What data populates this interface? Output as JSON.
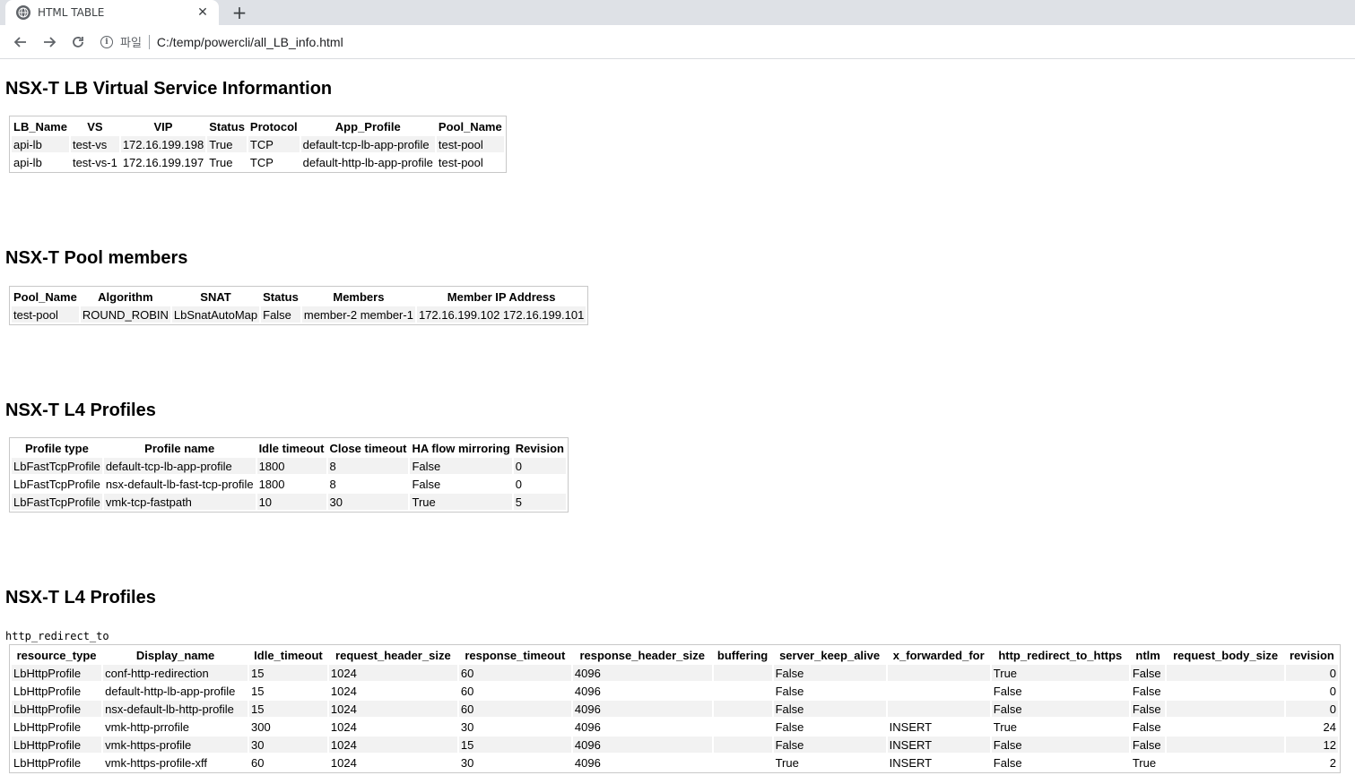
{
  "browser": {
    "tab_title": "HTML TABLE",
    "new_tab_glyph": "+",
    "close_glyph": "✕",
    "scheme_label": "파일",
    "url": "C:/temp/powercli/all_LB_info.html"
  },
  "sections": {
    "vs": {
      "title": "NSX-T LB Virtual Service Informantion",
      "headers": [
        "LB_Name",
        "VS",
        "VIP",
        "Status",
        "Protocol",
        "App_Profile",
        "Pool_Name"
      ],
      "rows": [
        [
          "api-lb",
          "test-vs",
          "172.16.199.198",
          "True",
          "TCP",
          "default-tcp-lb-app-profile",
          "test-pool"
        ],
        [
          "api-lb",
          "test-vs-1",
          "172.16.199.197",
          "True",
          "TCP",
          "default-http-lb-app-profile",
          "test-pool"
        ]
      ]
    },
    "pool": {
      "title": "NSX-T Pool members",
      "headers": [
        "Pool_Name",
        "Algorithm",
        "SNAT",
        "Status",
        "Members",
        "Member IP Address"
      ],
      "rows": [
        [
          "test-pool",
          "ROUND_ROBIN",
          "LbSnatAutoMap",
          "False",
          "member-2 member-1",
          "172.16.199.102 172.16.199.101"
        ]
      ]
    },
    "l4": {
      "title": "NSX-T L4 Profiles",
      "headers": [
        "Profile type",
        "Profile name",
        "Idle timeout",
        "Close timeout",
        "HA flow mirroring",
        "Revision"
      ],
      "rows": [
        [
          "LbFastTcpProfile",
          "default-tcp-lb-app-profile",
          "1800",
          "8",
          "False",
          "0"
        ],
        [
          "LbFastTcpProfile",
          "nsx-default-lb-fast-tcp-profile",
          "1800",
          "8",
          "False",
          "0"
        ],
        [
          "LbFastTcpProfile",
          "vmk-tcp-fastpath",
          "10",
          "30",
          "True",
          "5"
        ]
      ]
    },
    "http": {
      "title": "NSX-T L4 Profiles",
      "pre_label": "http_redirect_to",
      "headers": [
        "resource_type",
        "Display_name",
        "Idle_timeout",
        "request_header_size",
        "response_timeout",
        "response_header_size",
        "buffering",
        "server_keep_alive",
        "x_forwarded_for",
        "http_redirect_to_https",
        "ntlm",
        "request_body_size",
        "revision"
      ],
      "rows": [
        [
          "LbHttpProfile",
          "conf-http-redirection",
          "15",
          "1024",
          "60",
          "4096",
          "",
          "False",
          "",
          "True",
          "False",
          "",
          "0"
        ],
        [
          "LbHttpProfile",
          "default-http-lb-app-profile",
          "15",
          "1024",
          "60",
          "4096",
          "",
          "False",
          "",
          "False",
          "False",
          "",
          "0"
        ],
        [
          "LbHttpProfile",
          "nsx-default-lb-http-profile",
          "15",
          "1024",
          "60",
          "4096",
          "",
          "False",
          "",
          "False",
          "False",
          "",
          "0"
        ],
        [
          "LbHttpProfile",
          "vmk-http-prrofile",
          "300",
          "1024",
          "30",
          "4096",
          "",
          "False",
          "INSERT",
          "True",
          "False",
          "",
          "24"
        ],
        [
          "LbHttpProfile",
          "vmk-https-profile",
          "30",
          "1024",
          "15",
          "4096",
          "",
          "False",
          "INSERT",
          "False",
          "False",
          "",
          "12"
        ],
        [
          "LbHttpProfile",
          "vmk-https-profile-xff",
          "60",
          "1024",
          "30",
          "4096",
          "",
          "True",
          "INSERT",
          "False",
          "True",
          "",
          "2"
        ]
      ]
    }
  }
}
